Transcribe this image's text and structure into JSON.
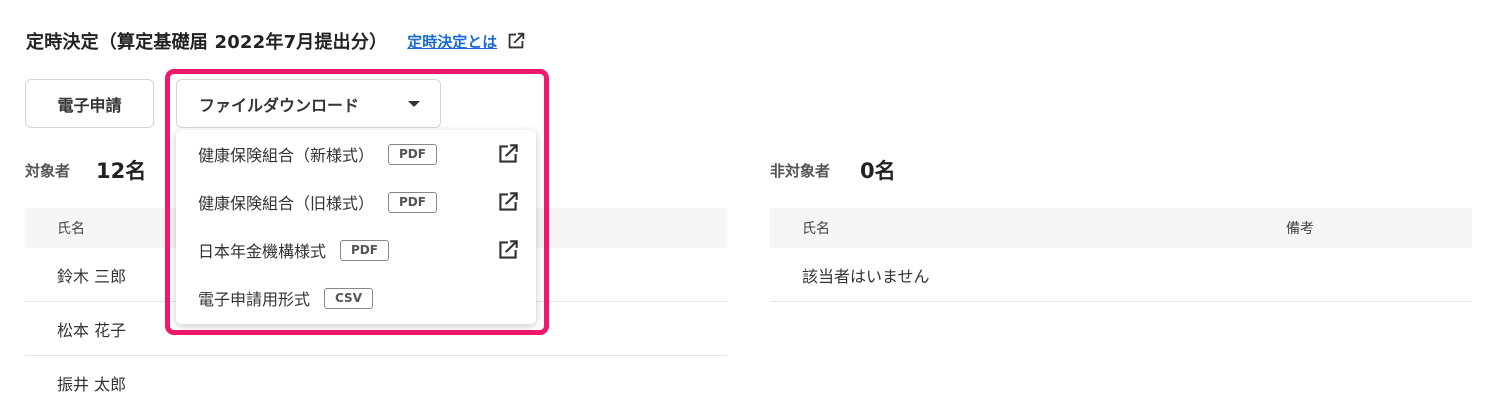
{
  "header": {
    "title": "定時決定（算定基礎届 2022年7月提出分）",
    "help_link": "定時決定とは"
  },
  "toolbar": {
    "efile_label": "電子申請",
    "download_label": "ファイルダウンロード"
  },
  "download_menu": {
    "items": [
      {
        "label": "健康保険組合（新様式）",
        "format": "PDF",
        "external": true
      },
      {
        "label": "健康保険組合（旧様式）",
        "format": "PDF",
        "external": true
      },
      {
        "label": "日本年金機構様式",
        "format": "PDF",
        "external": true
      },
      {
        "label": "電子申請用形式",
        "format": "CSV",
        "external": false
      }
    ]
  },
  "targets": {
    "label": "対象者",
    "count": "12名",
    "columns": [
      "氏名"
    ],
    "rows": [
      "鈴木 三郎",
      "松本 花子",
      "振井 太郎"
    ]
  },
  "non_targets": {
    "label": "非対象者",
    "count": "0名",
    "columns": [
      "氏名",
      "備考"
    ],
    "empty_message": "該当者はいません"
  },
  "colors": {
    "accent_link": "#1a6ad8",
    "highlight": "#f0186b",
    "header_bg": "#f6f4f4"
  }
}
